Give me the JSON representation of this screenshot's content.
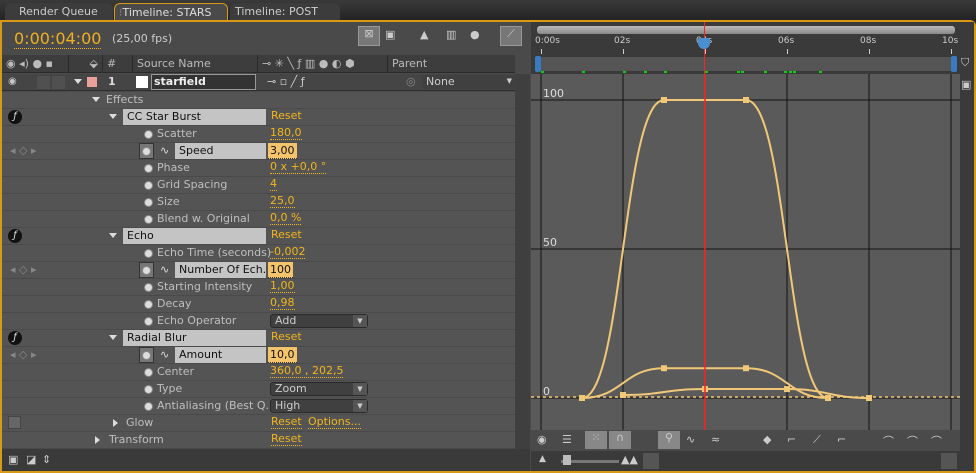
{
  "tabs": [
    {
      "label": "Render Queue",
      "active": false
    },
    {
      "label": "Timeline: STARS",
      "active": true,
      "close": "×"
    },
    {
      "label": "Timeline: POST",
      "active": false
    }
  ],
  "timecode": "0:00:04:00",
  "fps": "(25,00 fps)",
  "columns": {
    "number": "#",
    "source": "Source Name",
    "parent": "Parent"
  },
  "layer": {
    "index": "1",
    "name": "starfield",
    "parent": "None",
    "label_color": "#e8a098"
  },
  "rows": [
    {
      "type": "section",
      "label": "Effects",
      "indent": 93
    },
    {
      "type": "effect",
      "label": "CC Star Burst",
      "reset": "Reset"
    },
    {
      "type": "prop",
      "label": "Scatter",
      "value": "180,0"
    },
    {
      "type": "anim",
      "label": "Speed",
      "value": "3,00"
    },
    {
      "type": "prop",
      "label": "Phase",
      "value": "0 x +0,0 °"
    },
    {
      "type": "prop",
      "label": "Grid Spacing",
      "value": "4"
    },
    {
      "type": "prop",
      "label": "Size",
      "value": "25,0"
    },
    {
      "type": "prop",
      "label": "Blend w. Original",
      "value": "0,0 %"
    },
    {
      "type": "effect",
      "label": "Echo",
      "reset": "Reset"
    },
    {
      "type": "prop",
      "label": "Echo Time (seconds)",
      "value": "-0,002"
    },
    {
      "type": "anim",
      "label": "Number Of Ech...",
      "value": "100"
    },
    {
      "type": "prop",
      "label": "Starting Intensity",
      "value": "1,00"
    },
    {
      "type": "prop",
      "label": "Decay",
      "value": "0,98"
    },
    {
      "type": "dropdown",
      "label": "Echo Operator",
      "value": "Add"
    },
    {
      "type": "effect",
      "label": "Radial Blur",
      "reset": "Reset"
    },
    {
      "type": "anim",
      "label": "Amount",
      "value": "10,0"
    },
    {
      "type": "prop",
      "label": "Center",
      "value": "360,0 , 202,5"
    },
    {
      "type": "dropdown",
      "label": "Type",
      "value": "Zoom"
    },
    {
      "type": "dropdown",
      "label": "Antialiasing (Best Q...",
      "value": "High"
    },
    {
      "type": "collapsed",
      "label": "Glow",
      "reset": "Reset",
      "options": "Options..."
    },
    {
      "type": "section2",
      "label": "Transform",
      "reset": "Reset"
    }
  ],
  "ruler": {
    "ticks": [
      "0:00s",
      "02s",
      "04s",
      "06s",
      "08s",
      "10s"
    ]
  },
  "graph": {
    "y_labels": [
      "100",
      "50",
      "0"
    ],
    "colors": {
      "curve": "#f0c878",
      "playhead": "#ff2020",
      "accent": "#d89a16"
    },
    "playhead_time": 4,
    "curves": [
      {
        "keys": [
          [
            1,
            0
          ],
          [
            3,
            100
          ],
          [
            5,
            100
          ],
          [
            7,
            0
          ]
        ]
      },
      {
        "keys": [
          [
            1,
            0
          ],
          [
            3,
            10
          ],
          [
            5,
            10
          ],
          [
            7,
            0
          ]
        ]
      },
      {
        "keys": [
          [
            2,
            1
          ],
          [
            4,
            3
          ],
          [
            6,
            3
          ],
          [
            8,
            0
          ]
        ]
      }
    ]
  }
}
